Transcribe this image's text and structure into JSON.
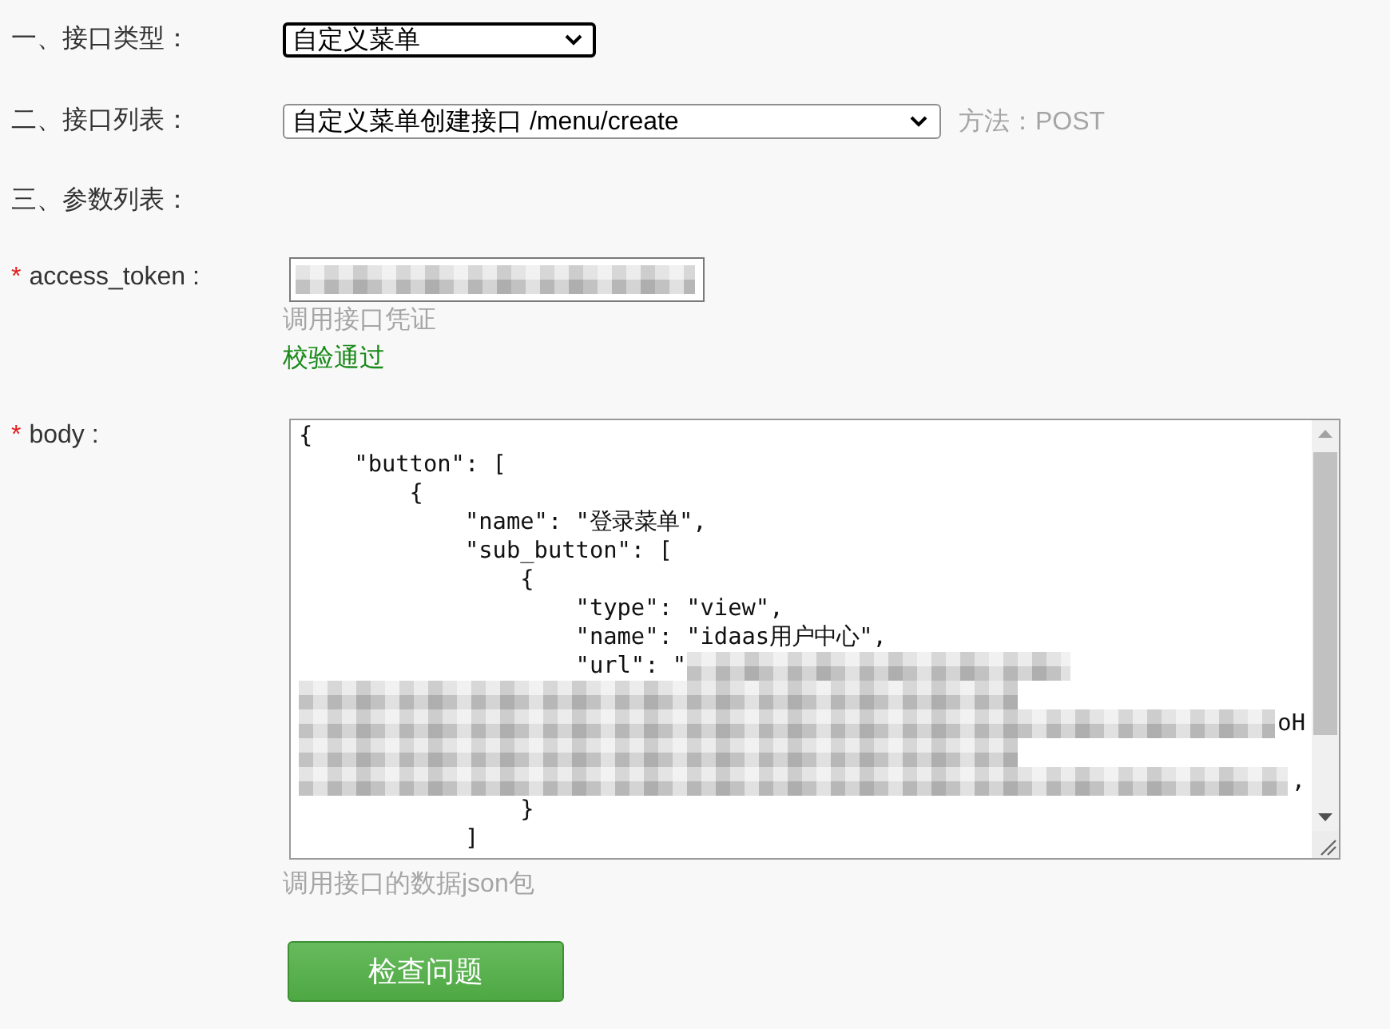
{
  "fields": [
    {
      "kind": "select",
      "label": "一、接口类型：",
      "value": "自定义菜单",
      "focused": true
    },
    {
      "kind": "select",
      "label": "二、接口列表：",
      "value": "自定义菜单创建接口 /menu/create",
      "focused": false,
      "note": "方法：POST"
    },
    {
      "kind": "heading",
      "label": "三、参数列表："
    },
    {
      "kind": "input",
      "required_mark": "*",
      "label": "access_token :",
      "value_redacted": true,
      "hint": "调用接口凭证",
      "status": "校验通过"
    },
    {
      "kind": "textarea",
      "required_mark": "*",
      "label": "body :",
      "lines": [
        {
          "kind": "code",
          "text": "{",
          "redacted": false
        },
        {
          "kind": "code",
          "text": "    \"button\": [",
          "redacted": false
        },
        {
          "kind": "code",
          "text": "        {",
          "redacted": false
        },
        {
          "kind": "code",
          "text": "            \"name\": \"登录菜单\",",
          "redacted": false
        },
        {
          "kind": "code",
          "text": "            \"sub_button\": [",
          "redacted": false
        },
        {
          "kind": "code",
          "text": "                {",
          "redacted": false
        },
        {
          "kind": "code",
          "text": "                    \"type\": \"view\",",
          "redacted": false
        },
        {
          "kind": "code",
          "text": "                    \"name\": \"idaas用户中心\",",
          "redacted": false
        },
        {
          "kind": "code",
          "text": "                    \"url\": \"",
          "redacted": true
        },
        {
          "kind": "redacted"
        },
        {
          "kind": "redacted",
          "text": "oH"
        },
        {
          "kind": "redacted"
        },
        {
          "kind": "redacted",
          "text": ","
        },
        {
          "kind": "code",
          "text": "                }",
          "redacted": false
        },
        {
          "kind": "code",
          "text": "            ]",
          "redacted": false
        }
      ],
      "hint": "调用接口的数据json包"
    }
  ],
  "submit": {
    "label": "检查问题"
  }
}
